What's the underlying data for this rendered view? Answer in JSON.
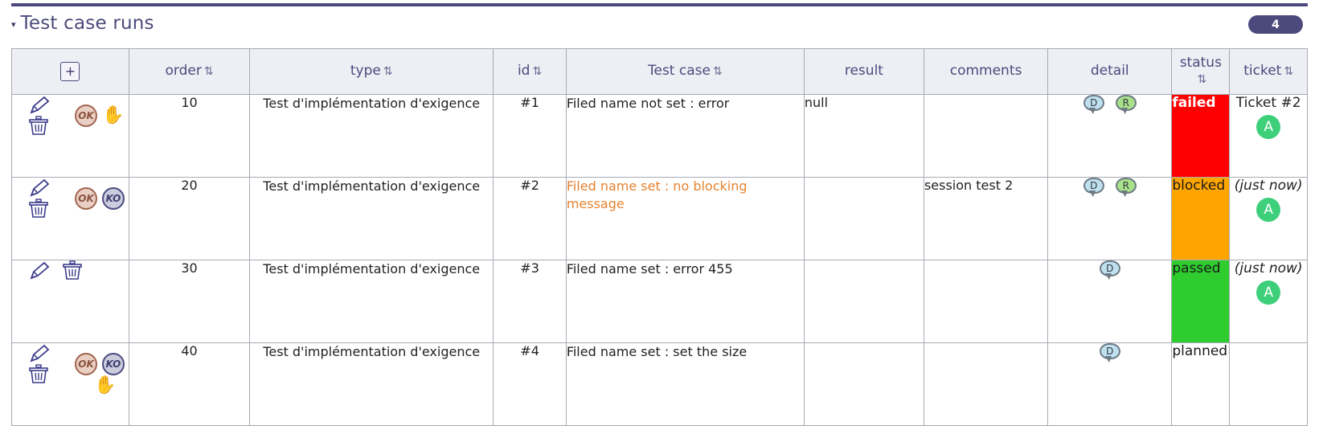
{
  "section": {
    "title": "Test case runs",
    "caret": "▾",
    "badge_count": "4"
  },
  "table": {
    "sort_icon": "⇅",
    "add_button_label": "+",
    "headers": [
      {
        "label": "",
        "sortable": false
      },
      {
        "label": "order",
        "sortable": true
      },
      {
        "label": "type",
        "sortable": true
      },
      {
        "label": "id",
        "sortable": true
      },
      {
        "label": "Test case",
        "sortable": true
      },
      {
        "label": "result",
        "sortable": false
      },
      {
        "label": "comments",
        "sortable": false
      },
      {
        "label": "detail",
        "sortable": false
      },
      {
        "label": "status",
        "sortable": true
      },
      {
        "label": "ticket",
        "sortable": true
      }
    ],
    "rows": [
      {
        "order": "10",
        "type": "Test d'implémentation d'exigence",
        "id": "#1",
        "test_case": "Filed name not set : error",
        "test_case_link": false,
        "result": "null",
        "comments": "",
        "detail_icons": [
          "D",
          "R"
        ],
        "status": "failed",
        "status_class": "status-failed",
        "ticket_text": "Ticket #2",
        "ticket_italic": false,
        "avatar": "A",
        "actions": {
          "pencil": true,
          "trash": true,
          "inline": false,
          "ok": true,
          "ko": false,
          "hand": true,
          "hand_second_row": false
        }
      },
      {
        "order": "20",
        "type": "Test d'implémentation d'exigence",
        "id": "#2",
        "test_case": "Filed name set : no blocking message",
        "test_case_link": true,
        "result": "",
        "comments": "session test 2",
        "detail_icons": [
          "D",
          "R"
        ],
        "status": "blocked",
        "status_class": "status-blocked",
        "ticket_text": "(just now)",
        "ticket_italic": true,
        "avatar": "A",
        "actions": {
          "pencil": true,
          "trash": true,
          "inline": false,
          "ok": true,
          "ko": true,
          "hand": false,
          "hand_second_row": false
        }
      },
      {
        "order": "30",
        "type": "Test d'implémentation d'exigence",
        "id": "#3",
        "test_case": "Filed name set : error 455",
        "test_case_link": false,
        "result": "",
        "comments": "",
        "detail_icons": [
          "D"
        ],
        "status": "passed",
        "status_class": "status-passed",
        "ticket_text": "(just now)",
        "ticket_italic": true,
        "avatar": "A",
        "actions": {
          "pencil": true,
          "trash": true,
          "inline": true,
          "ok": false,
          "ko": false,
          "hand": false,
          "hand_second_row": false
        }
      },
      {
        "order": "40",
        "type": "Test d'implémentation d'exigence",
        "id": "#4",
        "test_case": "Filed name set : set the size",
        "test_case_link": false,
        "result": "",
        "comments": "",
        "detail_icons": [
          "D"
        ],
        "status": "planned",
        "status_class": "status-planned",
        "ticket_text": "",
        "ticket_italic": false,
        "avatar": "",
        "actions": {
          "pencil": true,
          "trash": true,
          "inline": false,
          "ok": true,
          "ko": true,
          "hand": true,
          "hand_second_row": true
        }
      }
    ]
  },
  "icons": {
    "pencil": "pencil-icon",
    "trash": "trash-icon",
    "ok_badge": "OK",
    "ko_badge": "KO",
    "hand": "✋"
  },
  "colors": {
    "accent": "#4c4a7c",
    "header_bg": "#eeeef5",
    "link_orange": "#e6822f",
    "status_failed": "#ff0000",
    "status_blocked": "#ffa500",
    "status_passed": "#2ecc2e",
    "avatar_green": "#3ecf7a"
  }
}
